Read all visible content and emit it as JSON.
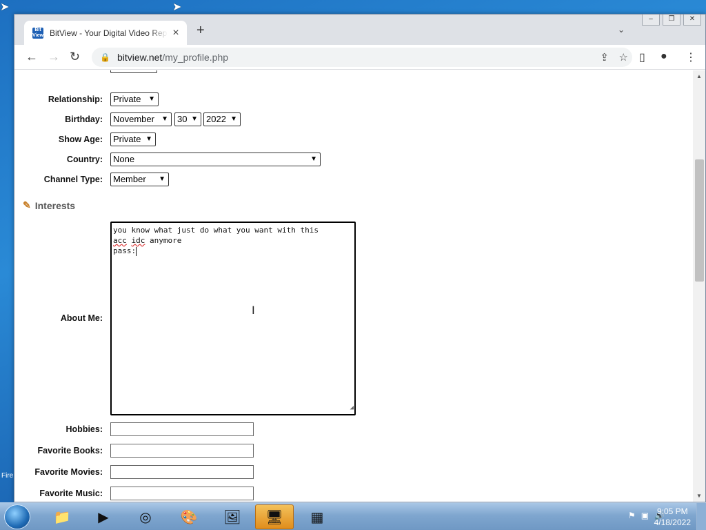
{
  "browser": {
    "tab_title": "BitView - Your Digital Video Repository",
    "favicon_text": "Bit View",
    "url_host": "bitview.net",
    "url_path": "/my_profile.php"
  },
  "form": {
    "relationship": {
      "label": "Relationship:",
      "value": "Private"
    },
    "birthday": {
      "label": "Birthday:",
      "month": "November",
      "day": "30",
      "year": "2022"
    },
    "show_age": {
      "label": "Show Age:",
      "value": "Private"
    },
    "country": {
      "label": "Country:",
      "value": "None"
    },
    "channel_type": {
      "label": "Channel Type:",
      "value": "Member"
    },
    "interests_heading": "Interests",
    "about_me": {
      "label": "About Me:",
      "line1": "you know what just do what you want with this",
      "line2_word1": "acc",
      "line2_word2": "idc",
      "line2_rest": " anymore",
      "line3": "pass:"
    },
    "hobbies": {
      "label": "Hobbies:",
      "value": ""
    },
    "favorite_books": {
      "label": "Favorite Books:",
      "value": ""
    },
    "favorite_movies": {
      "label": "Favorite Movies:",
      "value": ""
    },
    "favorite_music": {
      "label": "Favorite Music:",
      "value": ""
    }
  },
  "taskbar": {
    "time": "9:05 PM",
    "date": "4/18/2022",
    "desktop_label": "Fire"
  }
}
